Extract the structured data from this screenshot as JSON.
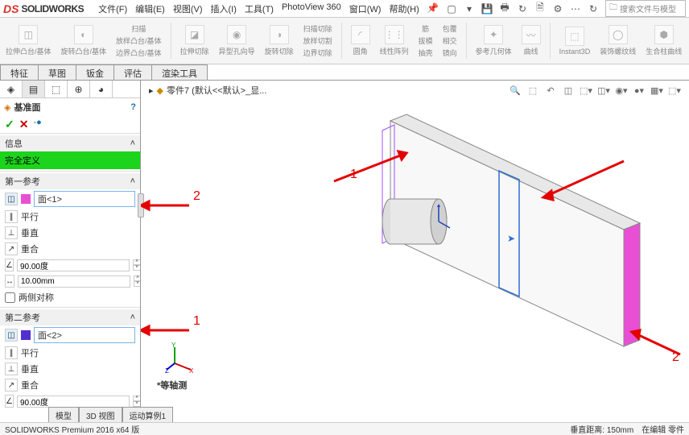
{
  "app": {
    "logo_prefix": "DS",
    "logo_name": "SOLIDWORKS"
  },
  "menu": {
    "file": "文件(F)",
    "edit": "编辑(E)",
    "view": "视图(V)",
    "insert": "插入(I)",
    "tools": "工具(T)",
    "photoview": "PhotoView 360",
    "window": "窗口(W)",
    "help": "帮助(H)"
  },
  "search": {
    "placeholder": "搜索文件与模型"
  },
  "ribbon": {
    "g1": "拉伸凸台/基体",
    "g2": "旋转凸台/基体",
    "g3": "扫描",
    "g4": "放样凸台/基体",
    "g5": "边界凸台/基体",
    "g6": "拉伸切除",
    "g7": "异型孔向导",
    "g8": "旋转切除",
    "g9": "扫描切除",
    "g10": "放样切割",
    "g11": "边界切除",
    "g12": "圆角",
    "g13": "线性阵列",
    "g14": "筋",
    "g15": "拔模",
    "g16": "抽壳",
    "g17": "包覆",
    "g18": "相交",
    "g19": "镜向",
    "g20": "参考几何体",
    "g21": "曲线",
    "g22": "Instant3D",
    "g23": "装饰螺纹线",
    "g24": "生合柱曲线"
  },
  "tabs": {
    "t1": "特征",
    "t2": "草图",
    "t3": "钣金",
    "t4": "评估",
    "t5": "渲染工具"
  },
  "panel": {
    "title": "基准面",
    "info_title": "信息",
    "info_status": "完全定义",
    "ref1_title": "第一参考",
    "ref1_face": "面<1>",
    "opt_parallel": "平行",
    "opt_perp": "垂直",
    "opt_coincident": "重合",
    "val_angle": "90.00度",
    "val_dist": "10.00mm",
    "opt_both": "两侧对称",
    "ref2_title": "第二参考",
    "ref2_face": "面<2>"
  },
  "breadcrumb": {
    "part": "零件7 (默认<<默认>_显..."
  },
  "viewport": {
    "view_label": "*等轴测",
    "ann1": "1",
    "ann2": "2",
    "ann3": "1",
    "ann4": "2"
  },
  "bottom_tabs": {
    "bt1": "模型",
    "bt2": "3D 视图",
    "bt3": "运动算例1"
  },
  "status": {
    "left": "SOLIDWORKS Premium 2016 x64 版",
    "dist": "垂直距离: 150mm",
    "mode": "在编辑 零件"
  }
}
